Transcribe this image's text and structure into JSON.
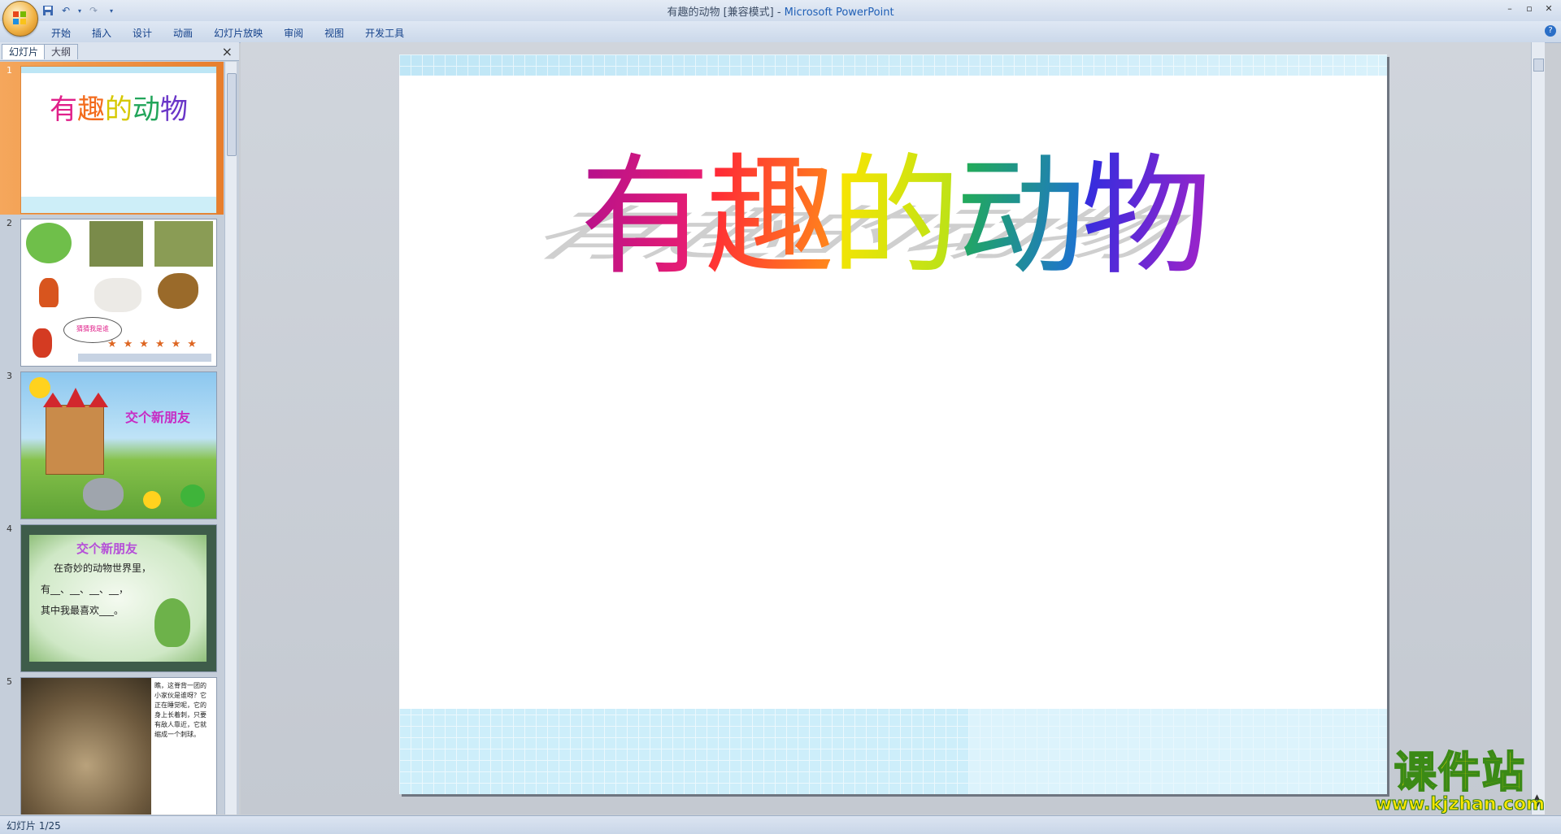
{
  "window": {
    "title_prefix": "有趣的动物 [兼容模式] - ",
    "app_name": "Microsoft PowerPoint"
  },
  "ribbon": {
    "tabs": [
      "开始",
      "插入",
      "设计",
      "动画",
      "幻灯片放映",
      "审阅",
      "视图",
      "开发工具"
    ]
  },
  "panel": {
    "tab_slides": "幻灯片",
    "tab_outline": "大纲"
  },
  "thumbnails": [
    {
      "num": "1",
      "title": "有趣的动物"
    },
    {
      "num": "2",
      "bubble": "猜猜我是谁"
    },
    {
      "num": "3",
      "title": "交个新朋友"
    },
    {
      "num": "4",
      "title": "交个新朋友",
      "line1": "在奇妙的动物世界里，",
      "line2": "有__、__、__、__，",
      "line3": "其中我最喜欢___。"
    },
    {
      "num": "5",
      "text": "瞧，这脊背一团的小家伙是谁呀？它正在睡觉呢，它的身上长着刺，只要有敌人靠近，它就缩成一个刺球。"
    }
  ],
  "slide": {
    "title_chars": [
      "有",
      "趣",
      "的",
      "动",
      "物"
    ]
  },
  "status": {
    "slide_indicator": "幻灯片 1/25"
  },
  "watermark": {
    "main": "课件站",
    "url": "www.kjzhan.com"
  }
}
